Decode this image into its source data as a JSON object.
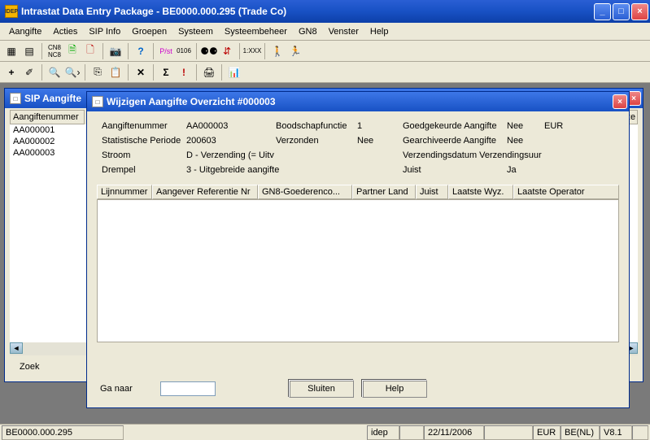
{
  "app": {
    "title": "Intrastat Data Entry Package - BE0000.000.295 (Trade Co)",
    "icon": "IDEP"
  },
  "menu": {
    "items": [
      "Aangifte",
      "Acties",
      "SIP Info",
      "Groepen",
      "Systeem",
      "Systeembeheer",
      "GN8",
      "Venster",
      "Help"
    ]
  },
  "sip_window": {
    "title": "SIP Aangifte",
    "header": "Aangiftenummer",
    "items": [
      "AA000001",
      "AA000002",
      "AA000003"
    ],
    "zoek_label": "Zoek",
    "verze_header": "Verze"
  },
  "dialog": {
    "title": "Wijzigen Aangifte Overzicht #000003",
    "fields": {
      "aangiftenummer_label": "Aangiftenummer",
      "aangiftenummer_value": "AA000003",
      "boodschap_label": "Boodschapfunctie",
      "boodschap_value": "1",
      "goedgekeurde_label": "Goedgekeurde Aangifte",
      "goedgekeurde_value": "Nee",
      "currency": "EUR",
      "stat_periode_label": "Statistische Periode",
      "stat_periode_value": "200603",
      "verzonden_label": "Verzonden",
      "verzonden_value": "Nee",
      "gearchiveerde_label": "Gearchiveerde Aangifte",
      "gearchiveerde_value": "Nee",
      "stroom_label": "Stroom",
      "stroom_value": "D - Verzending (= Uitv",
      "verzendingsdatum_label": "Verzendingsdatum Verzendingsuur",
      "drempel_label": "Drempel",
      "drempel_value": "3 - Uitgebreide aangifte",
      "juist_label": "Juist",
      "juist_value": "Ja"
    },
    "columns": [
      "Lijnnummer",
      "Aangever Referentie Nr",
      "GN8-Goederenco...",
      "Partner Land",
      "Juist",
      "Laatste Wyz.",
      "Laatste Operator"
    ],
    "ga_naar_label": "Ga naar",
    "sluiten_label": "Sluiten",
    "help_label": "Help"
  },
  "status": {
    "code": "BE0000.000.295",
    "app": "idep",
    "date": "22/11/2006",
    "currency": "EUR",
    "locale": "BE(NL)",
    "version": "V8.1"
  }
}
